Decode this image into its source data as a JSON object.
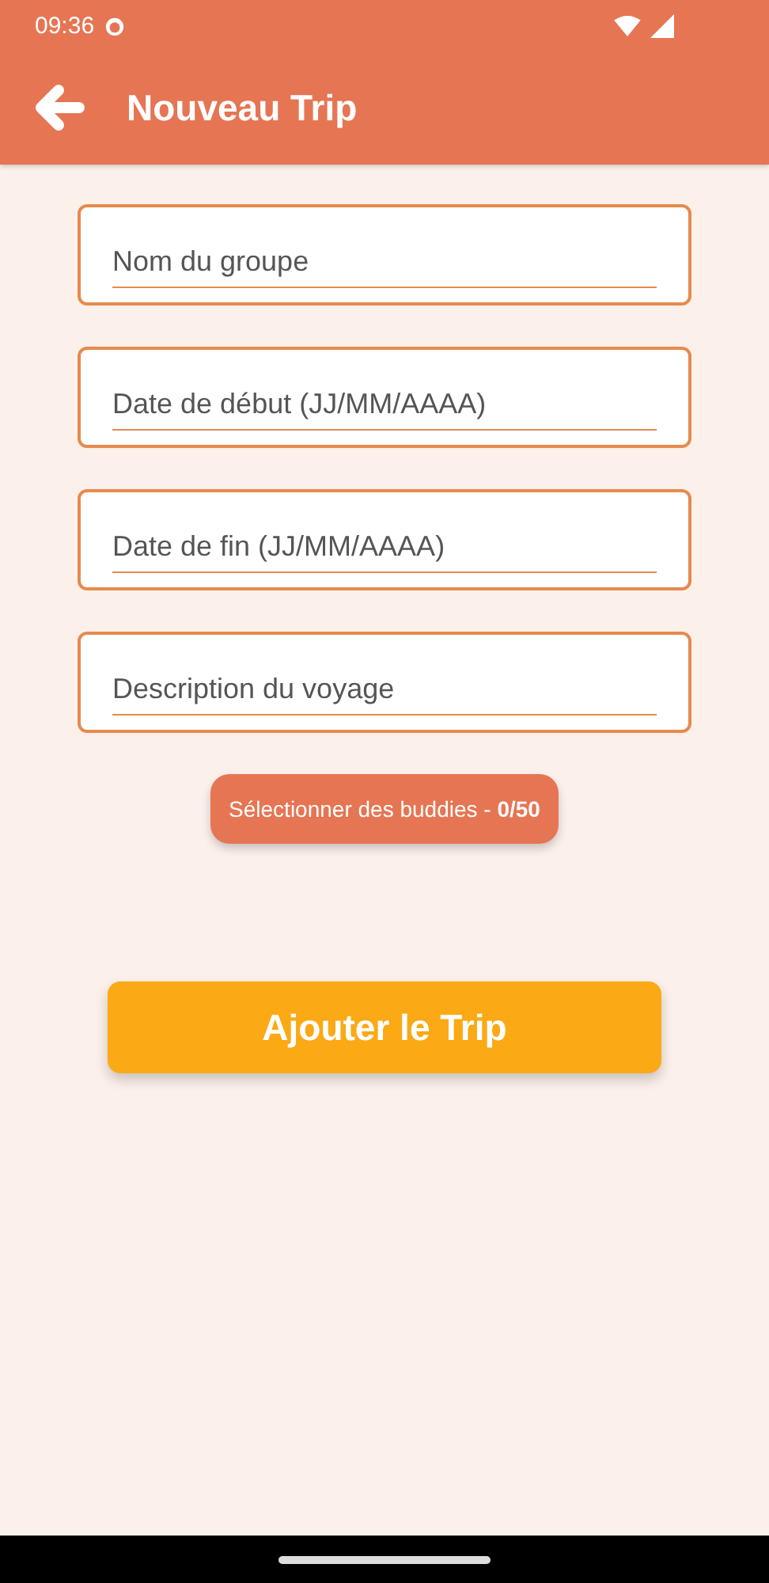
{
  "status_bar": {
    "time": "09:36"
  },
  "app_bar": {
    "title": "Nouveau Trip"
  },
  "fields": [
    {
      "placeholder": "Nom du groupe"
    },
    {
      "placeholder": "Date de début (JJ/MM/AAAA)"
    },
    {
      "placeholder": "Date de fin (JJ/MM/AAAA)"
    },
    {
      "placeholder": "Description du voyage"
    }
  ],
  "buddies_button": {
    "label": "Sélectionner des buddies - **0/50**"
  },
  "submit_button": {
    "label": "Ajouter le Trip"
  }
}
